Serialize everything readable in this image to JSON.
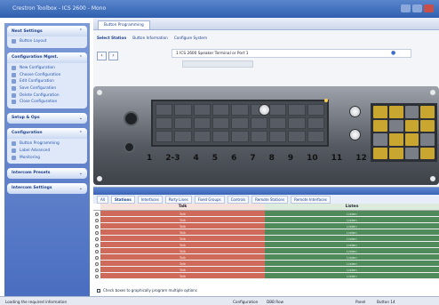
{
  "window": {
    "title": "Crestron Toolbox - ICS 2600 - Mono"
  },
  "sidebar": {
    "panels": [
      {
        "title": "Next Settings",
        "items": [
          {
            "label": "Button Layout",
            "icon": "layout-icon"
          }
        ]
      },
      {
        "title": "Configuration Mgmt.",
        "items": [
          {
            "label": "New Configuration",
            "icon": "new-icon"
          },
          {
            "label": "Choose Configuration",
            "icon": "choose-icon"
          },
          {
            "label": "Edit Configuration",
            "icon": "edit-icon"
          },
          {
            "label": "Save Configuration",
            "icon": "save-icon"
          },
          {
            "label": "Delete Configuration",
            "icon": "delete-icon"
          },
          {
            "label": "Close Configuration",
            "icon": "close-config-icon"
          }
        ]
      },
      {
        "title": "Setup & Ops",
        "items": []
      },
      {
        "title": "Configuration",
        "items": [
          {
            "label": "Button Programming",
            "icon": "button-prog-icon"
          },
          {
            "label": "Label Advanced",
            "icon": "label-icon"
          },
          {
            "label": "Monitoring",
            "icon": "monitor-icon"
          }
        ]
      },
      {
        "title": "Intercom Presets",
        "items": []
      },
      {
        "title": "Intercom Settings",
        "items": []
      }
    ]
  },
  "main": {
    "tab": "Button Programming",
    "subtabs": [
      "Select Station",
      "Button Information",
      "Configure System"
    ],
    "device_select": "1 ICS 2600 Speaker Terminal or Port 1",
    "keys": [
      "1",
      "2-3",
      "4",
      "5",
      "6",
      "7",
      "8",
      "9",
      "10",
      "11",
      "12"
    ]
  },
  "grid": {
    "tabs": [
      "All",
      "Stations",
      "Interfaces",
      "Party Lines",
      "Fixed Groups",
      "Controls",
      "Remote Stations",
      "Remote Interfaces"
    ],
    "active_tab": "Stations",
    "columns": [
      "Talk",
      "Listen"
    ],
    "rows": [
      {
        "talk": "Talk",
        "listen": "Listen"
      },
      {
        "talk": "Talk",
        "listen": "Listen"
      },
      {
        "talk": "Talk",
        "listen": "Listen"
      },
      {
        "talk": "Talk",
        "listen": "Listen"
      },
      {
        "talk": "Talk",
        "listen": "Listen"
      },
      {
        "talk": "Talk",
        "listen": "Listen"
      },
      {
        "talk": "Talk",
        "listen": "Listen"
      },
      {
        "talk": "Talk",
        "listen": "Listen"
      },
      {
        "talk": "Talk",
        "listen": "Listen"
      },
      {
        "talk": "Talk",
        "listen": "Listen"
      },
      {
        "talk": "Talk",
        "listen": "Listen"
      }
    ],
    "note": "Check boxes to graphically program multiple options"
  },
  "status": {
    "left": "Loading the required information",
    "config": "Configuration",
    "mode": "DBB Row",
    "page": "Panel",
    "button": "Button 14"
  },
  "colors": {
    "talk": "#cf6a5a",
    "listen": "#4e8a5a",
    "accent": "#2f5fae"
  }
}
